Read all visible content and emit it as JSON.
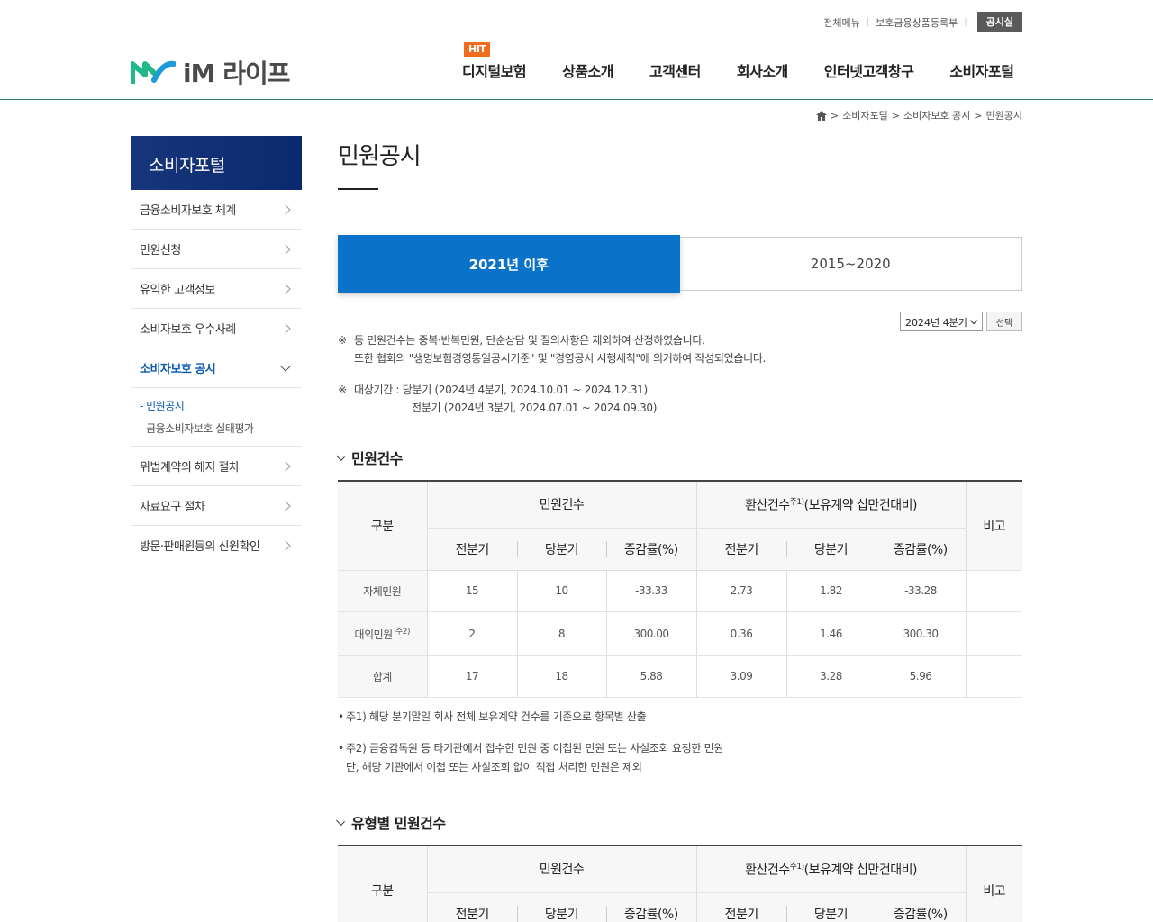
{
  "util": {
    "menu": "전체메뉴",
    "register": "보호금융상품등록부",
    "notice": "공시실"
  },
  "logo": {
    "text": "iM 라이프"
  },
  "gnb": {
    "hit": "HIT",
    "items": [
      "디지털보험",
      "상품소개",
      "고객센터",
      "회사소개",
      "인터넷고객창구",
      "소비자포털"
    ]
  },
  "breadcrumb": {
    "items": [
      "소비자포털",
      "소비자보호 공시",
      "민원공시"
    ],
    "sep": ">"
  },
  "sidebar": {
    "title": "소비자포털",
    "items": [
      "금융소비자보호 체계",
      "민원신청",
      "유익한 고객정보",
      "소비자보호 우수사례",
      "소비자보호 공시",
      "위법계약의 해지 절차",
      "자료요구 절차",
      "방문·판매원등의 신원확인"
    ],
    "sub": [
      "- 민원공시",
      "- 금융소비자보호 실태평가"
    ]
  },
  "page": {
    "title": "민원공시"
  },
  "tabs": [
    "2021년 이후",
    "2015~2020"
  ],
  "period": {
    "selected": "2024년 4분기",
    "button": "선택"
  },
  "notes": {
    "mark": "※",
    "line1": "동 민원건수는 중복·반복민원, 단순상담 및 질의사항은 제외하여 산정하였습니다.",
    "line2": "또한 협회의 \"생명보험경영통일공시기준\" 및 \"경영공시 시행세칙\"에 의거하여 작성되었습니다.",
    "line3": "대상기간 : 당분기 (2024년 4분기, 2024.10.01 ~ 2024.12.31)",
    "line4": "전분기 (2024년 3분기, 2024.07.01 ~ 2024.09.30)"
  },
  "section1": {
    "title": "민원건수"
  },
  "section2": {
    "title": "유형별 민원건수"
  },
  "table": {
    "col_group": "구분",
    "group1": "민원건수",
    "group2_pre": "환산건수",
    "group2_sup": "주1)",
    "group2_post": "(보유계약 십만건대비)",
    "remark": "비고",
    "sub": [
      "전분기",
      "당분기",
      "증감률(%)",
      "전분기",
      "당분기",
      "증감률(%)"
    ],
    "rows": [
      {
        "label": "자체민원",
        "sup": "",
        "values": [
          "15",
          "10",
          "-33.33",
          "2.73",
          "1.82",
          "-33.28"
        ]
      },
      {
        "label": "대외민원",
        "sup": "주2)",
        "values": [
          "2",
          "8",
          "300.00",
          "0.36",
          "1.46",
          "300.30"
        ]
      },
      {
        "label": "합계",
        "sup": "",
        "values": [
          "17",
          "18",
          "5.88",
          "3.09",
          "3.28",
          "5.96"
        ]
      }
    ]
  },
  "footnotes": {
    "bullet": "•",
    "fn1": "주1) 해당 분기말일 회사 전체 보유계약 건수를 기준으로 항목별 산출",
    "fn2": "주2) 금융감독원 등 타기관에서 접수한 민원 중 이첩된 민원 또는 사실조회 요청한 민원",
    "fn2b": "단, 해당 기관에서 이첩 또는 사실조회 없이 직접 처리한 민원은 제외"
  },
  "colors": {
    "brand_green": "#1fb48a",
    "nav_blue": "#0b2a6e",
    "tab_blue": "#0a72c8",
    "hit_orange": "#f26c1e",
    "active_blue": "#0a5ab0"
  }
}
